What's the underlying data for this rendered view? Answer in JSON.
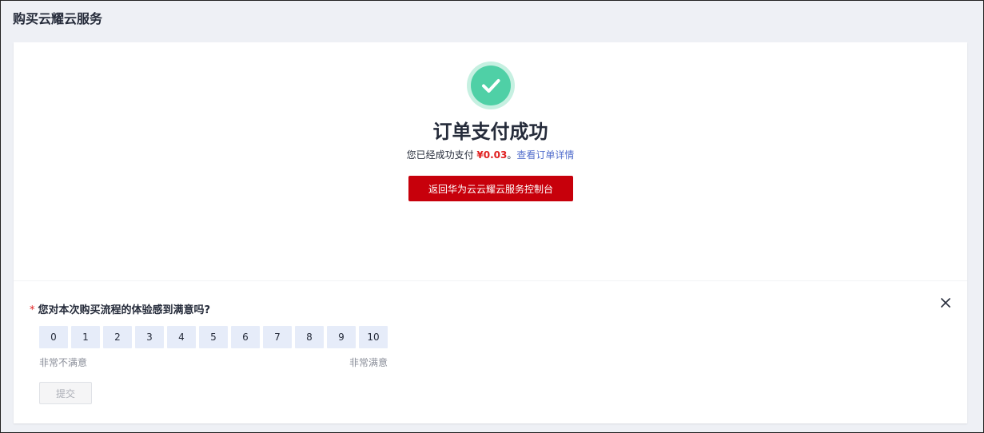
{
  "header": {
    "title": "购买云耀云服务"
  },
  "result": {
    "title": "订单支付成功",
    "sub_prefix": "您已经成功支付 ",
    "amount": "¥0.03",
    "sub_sep": "。",
    "order_link": "查看订单详情",
    "return_label": "返回华为云云耀云服务控制台",
    "icon": "check-circle-icon",
    "accent_color": "#4fd0a6",
    "button_color": "#c7000b"
  },
  "survey": {
    "required_mark": "*",
    "question": "您对本次购买流程的体验感到满意吗?",
    "scores": [
      "0",
      "1",
      "2",
      "3",
      "4",
      "5",
      "6",
      "7",
      "8",
      "9",
      "10"
    ],
    "low_label": "非常不满意",
    "high_label": "非常满意",
    "submit_label": "提交"
  }
}
